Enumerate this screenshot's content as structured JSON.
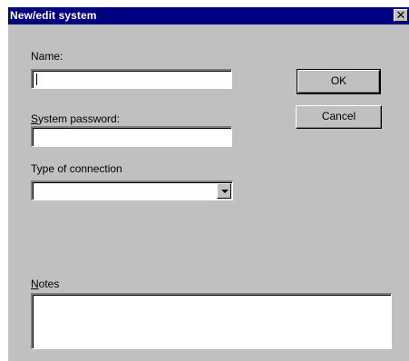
{
  "window": {
    "title": "New/edit system",
    "close_glyph": "✕"
  },
  "form": {
    "name_label_prefix": "Name:",
    "name_value": "",
    "password_label_mnemonic": "S",
    "password_label_rest": "ystem password:",
    "password_value": "",
    "connection_label": "Type of connection",
    "connection_selected": "",
    "notes_label_mnemonic": "N",
    "notes_label_rest": "otes",
    "notes_value": ""
  },
  "buttons": {
    "ok_label": "OK",
    "cancel_label": "Cancel"
  },
  "icons": {
    "close": "close-icon",
    "dropdown": "chevron-down-icon"
  }
}
